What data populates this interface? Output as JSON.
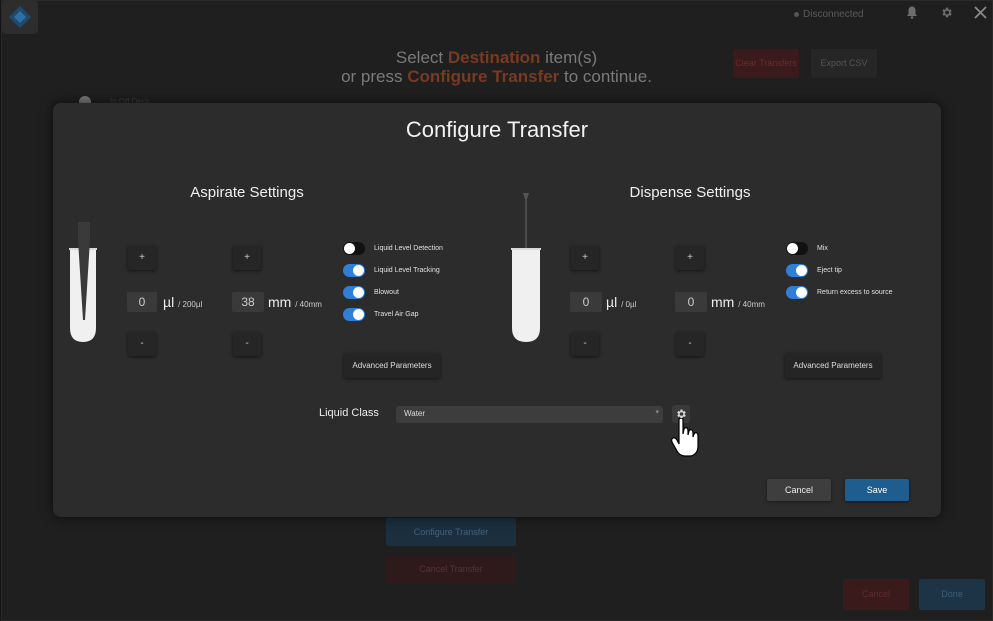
{
  "header": {
    "status_text": "Disconnected",
    "bell_icon": "bell-icon",
    "settings_icon": "gear-icon",
    "close_icon": "close-icon"
  },
  "background": {
    "instruction_line1_prefix": "Select ",
    "instruction_line1_highlight": "Destination",
    "instruction_line1_suffix": " item(s)",
    "instruction_line2_prefix": "or press ",
    "instruction_line2_highlight": "Configure Transfer",
    "instruction_line2_suffix": " to continue.",
    "clear_transfers_label": "Clear Transfers",
    "export_csv_label": "Export CSV",
    "side_label": "In Off Deck",
    "configure_transfer_label": "Configure Transfer",
    "cancel_transfer_label": "Cancel Transfer",
    "cancel_label": "Cancel",
    "done_label": "Done"
  },
  "modal": {
    "title": "Configure Transfer",
    "aspirate": {
      "title": "Aspirate Settings",
      "increment_label": "+",
      "decrement_label": "-",
      "volume_value": "0",
      "volume_unit": "µl",
      "volume_max": "/ 200µl",
      "height_value": "38",
      "height_unit": "mm",
      "height_max": "/ 40mm",
      "toggles": [
        {
          "label": "Liquid Level Detection",
          "on": false
        },
        {
          "label": "Liquid Level Tracking",
          "on": true
        },
        {
          "label": "Blowout",
          "on": true
        },
        {
          "label": "Travel Air Gap",
          "on": true
        }
      ],
      "advanced_label": "Advanced Parameters"
    },
    "dispense": {
      "title": "Dispense Settings",
      "increment_label": "+",
      "decrement_label": "-",
      "volume_value": "0",
      "volume_unit": "µl",
      "volume_max": "/ 0µl",
      "height_value": "0",
      "height_unit": "mm",
      "height_max": "/ 40mm",
      "toggles": [
        {
          "label": "Mix",
          "on": false
        },
        {
          "label": "Eject tip",
          "on": true
        },
        {
          "label": "Return excess to source",
          "on": true
        }
      ],
      "advanced_label": "Advanced Parameters"
    },
    "liquid_class": {
      "label": "Liquid Class",
      "value": "Water"
    },
    "cancel_label": "Cancel",
    "save_label": "Save"
  },
  "colors": {
    "accent_blue": "#2f7fd9",
    "save_blue": "#1f5d8e",
    "highlight_orange": "#7a3a22"
  }
}
